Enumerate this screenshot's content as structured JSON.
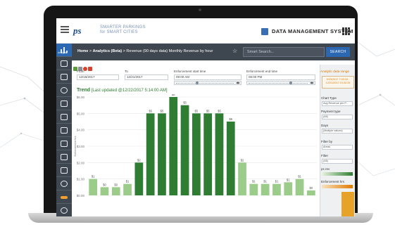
{
  "header": {
    "logo_mark": "ps",
    "logo_line1": "SMARTER PARKINGS",
    "logo_line2": "for SMART CITIES",
    "title": "DATA MANAGEMENT SYSTEM",
    "icons": [
      "hamburger-icon",
      "database-icon",
      "apps-grid-icon"
    ]
  },
  "sidebar": {
    "items": [
      {
        "icon": "analytics-icon",
        "label": "Analytic",
        "active": true
      },
      {
        "icon": "map-icon"
      },
      {
        "icon": "monitor-icon"
      },
      {
        "icon": "car-icon"
      },
      {
        "icon": "hand-icon"
      },
      {
        "icon": "list-icon"
      },
      {
        "icon": "document-icon"
      },
      {
        "icon": "wrench-icon"
      },
      {
        "icon": "close-box-icon"
      },
      {
        "icon": "bar-chart-icon"
      },
      {
        "icon": "user-icon"
      },
      {
        "icon": "ticket-icon"
      },
      {
        "icon": "signal-icon"
      },
      {
        "icon": "building-icon"
      },
      {
        "icon": "expand-icon"
      }
    ]
  },
  "breadcrumb": {
    "home": "Home",
    "sep1": ">",
    "analytics": "Analytics (Beta)",
    "sep2": ">",
    "current": "Revenue (90 days data) Monthly Revenue by hour"
  },
  "search": {
    "placeholder": "Smart Search...",
    "button": "SEARCH"
  },
  "filters": {
    "from_label": "From",
    "from_value": "12/15/2017",
    "to_label": "To",
    "to_value": "12/21/2017",
    "start_label": "Enforcement start time",
    "start_value": "09:00 AM",
    "end_label": "Enforcement end time",
    "end_value": "06:00 PM"
  },
  "chart_title": {
    "label": "Trend",
    "updated": "[Last updated @12/22/2017 5:14:00 AM]"
  },
  "right_panel": {
    "range_label": "Analytic data range",
    "range_value": "9/23/2017 7:00:34 - 12/21/2017 10:32:25",
    "chart_type_label": "Chart Type",
    "chart_type_value": "Avg Revenue per P...",
    "payment_label": "Payment type",
    "payment_value": "(All)",
    "days_label": "Days",
    "days_value": "(Multiple values)",
    "filter_by_label": "Filter by",
    "filter_by_value": "Areas",
    "filter_label": "Filter",
    "filter_value": "(All)",
    "ps_rev_label": "ps rev",
    "enforcement_label": "Enforcement hrs"
  },
  "colors": {
    "sidebar": "#3e4650",
    "accent": "#2b68b1",
    "bar_dark": "#2e7d32",
    "bar_light": "#9ccc8a",
    "orange": "#e7a22a"
  },
  "chart_data": {
    "type": "bar",
    "title": "",
    "ylabel": "Enforcement hrs",
    "ylim": [
      0,
      6
    ],
    "yticks": [
      "$0.00",
      "$1.00",
      "$2.00",
      "$3.00",
      "$4.00",
      "$5.00",
      "$6.00"
    ],
    "categories": [
      "0",
      "1",
      "2",
      "3",
      "4",
      "5",
      "6",
      "7",
      "8",
      "9",
      "10",
      "11",
      "12",
      "13",
      "14",
      "15",
      "16",
      "17",
      "18",
      "19"
    ],
    "values": [
      1,
      0.5,
      0.5,
      0.7,
      2,
      5,
      5,
      6,
      5.5,
      5,
      5,
      5,
      4.5,
      2,
      0.7,
      0.7,
      0.7,
      0.8,
      1,
      0.3
    ],
    "data_labels": [
      "$1",
      "$0",
      "$0",
      "$1",
      "$2",
      "$5",
      "$5",
      "$6",
      "$5",
      "$5",
      "$5",
      "$5",
      "$5",
      "$2",
      "$1",
      "$1",
      "$1",
      "$1",
      "$1",
      "$0"
    ],
    "highlighted": [
      4,
      5,
      6,
      7,
      8,
      9,
      10,
      11,
      12
    ],
    "grid": true
  }
}
